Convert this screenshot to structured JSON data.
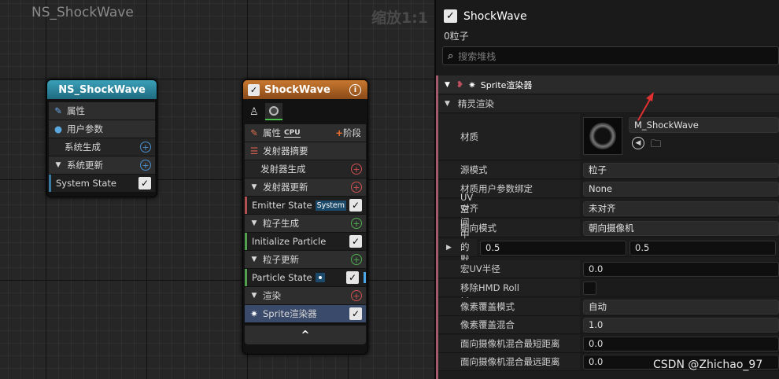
{
  "graph": {
    "title": "NS_ShockWave",
    "zoom": "缩放1:1"
  },
  "system_node": {
    "title": "NS_ShockWave",
    "rows": [
      "属性",
      "用户参数",
      "系统生成",
      "系统更新",
      "System State"
    ]
  },
  "emitter_node": {
    "title": "ShockWave",
    "attr_label": "属性",
    "cpu_label": "CPU",
    "stage_label": "阶段",
    "summary": "发射器摘要",
    "emitter_spawn": "发射器生成",
    "emitter_update": "发射器更新",
    "emitter_state": "Emitter State",
    "system_tag": "System",
    "particle_spawn": "粒子生成",
    "initialize_particle": "Initialize Particle",
    "particle_update": "粒子更新",
    "particle_state": "Particle State",
    "render": "渲染",
    "sprite_renderer": "Sprite渲染器",
    "collapse": "^"
  },
  "panel": {
    "title": "ShockWave",
    "subtitle": "0粒子",
    "search_placeholder": "搜索堆栈",
    "section_title": "Sprite渲染器",
    "subsection_title": "精灵渲染",
    "material_label": "材质",
    "material_value": "M_ShockWave",
    "props": [
      {
        "label": "源模式",
        "value": "粒子"
      },
      {
        "label": "材质用户参数绑定",
        "value": "None"
      },
      {
        "label": "对齐",
        "value": "未对齐"
      },
      {
        "label": "朝向模式",
        "value": "朝向摄像机"
      },
      {
        "label": "UV空间中的默认轴点",
        "value": "0.5",
        "value2": "0.5"
      },
      {
        "label": "宏UV半径",
        "value": "0.0"
      },
      {
        "label": "移除HMD Roll",
        "value": ""
      },
      {
        "label": "像素覆盖模式",
        "value": "自动"
      },
      {
        "label": "像素覆盖混合",
        "value": "1.0"
      },
      {
        "label": "面向摄像机混合最短距离",
        "value": "0.0"
      },
      {
        "label": "面向摄像机混合最远距离",
        "value": "0.0"
      }
    ]
  },
  "watermark": "CSDN @Zhichao_97",
  "colors": {
    "accent_red": "#e03030",
    "system_header": "#2a7a90",
    "emitter_header": "#b06020"
  }
}
